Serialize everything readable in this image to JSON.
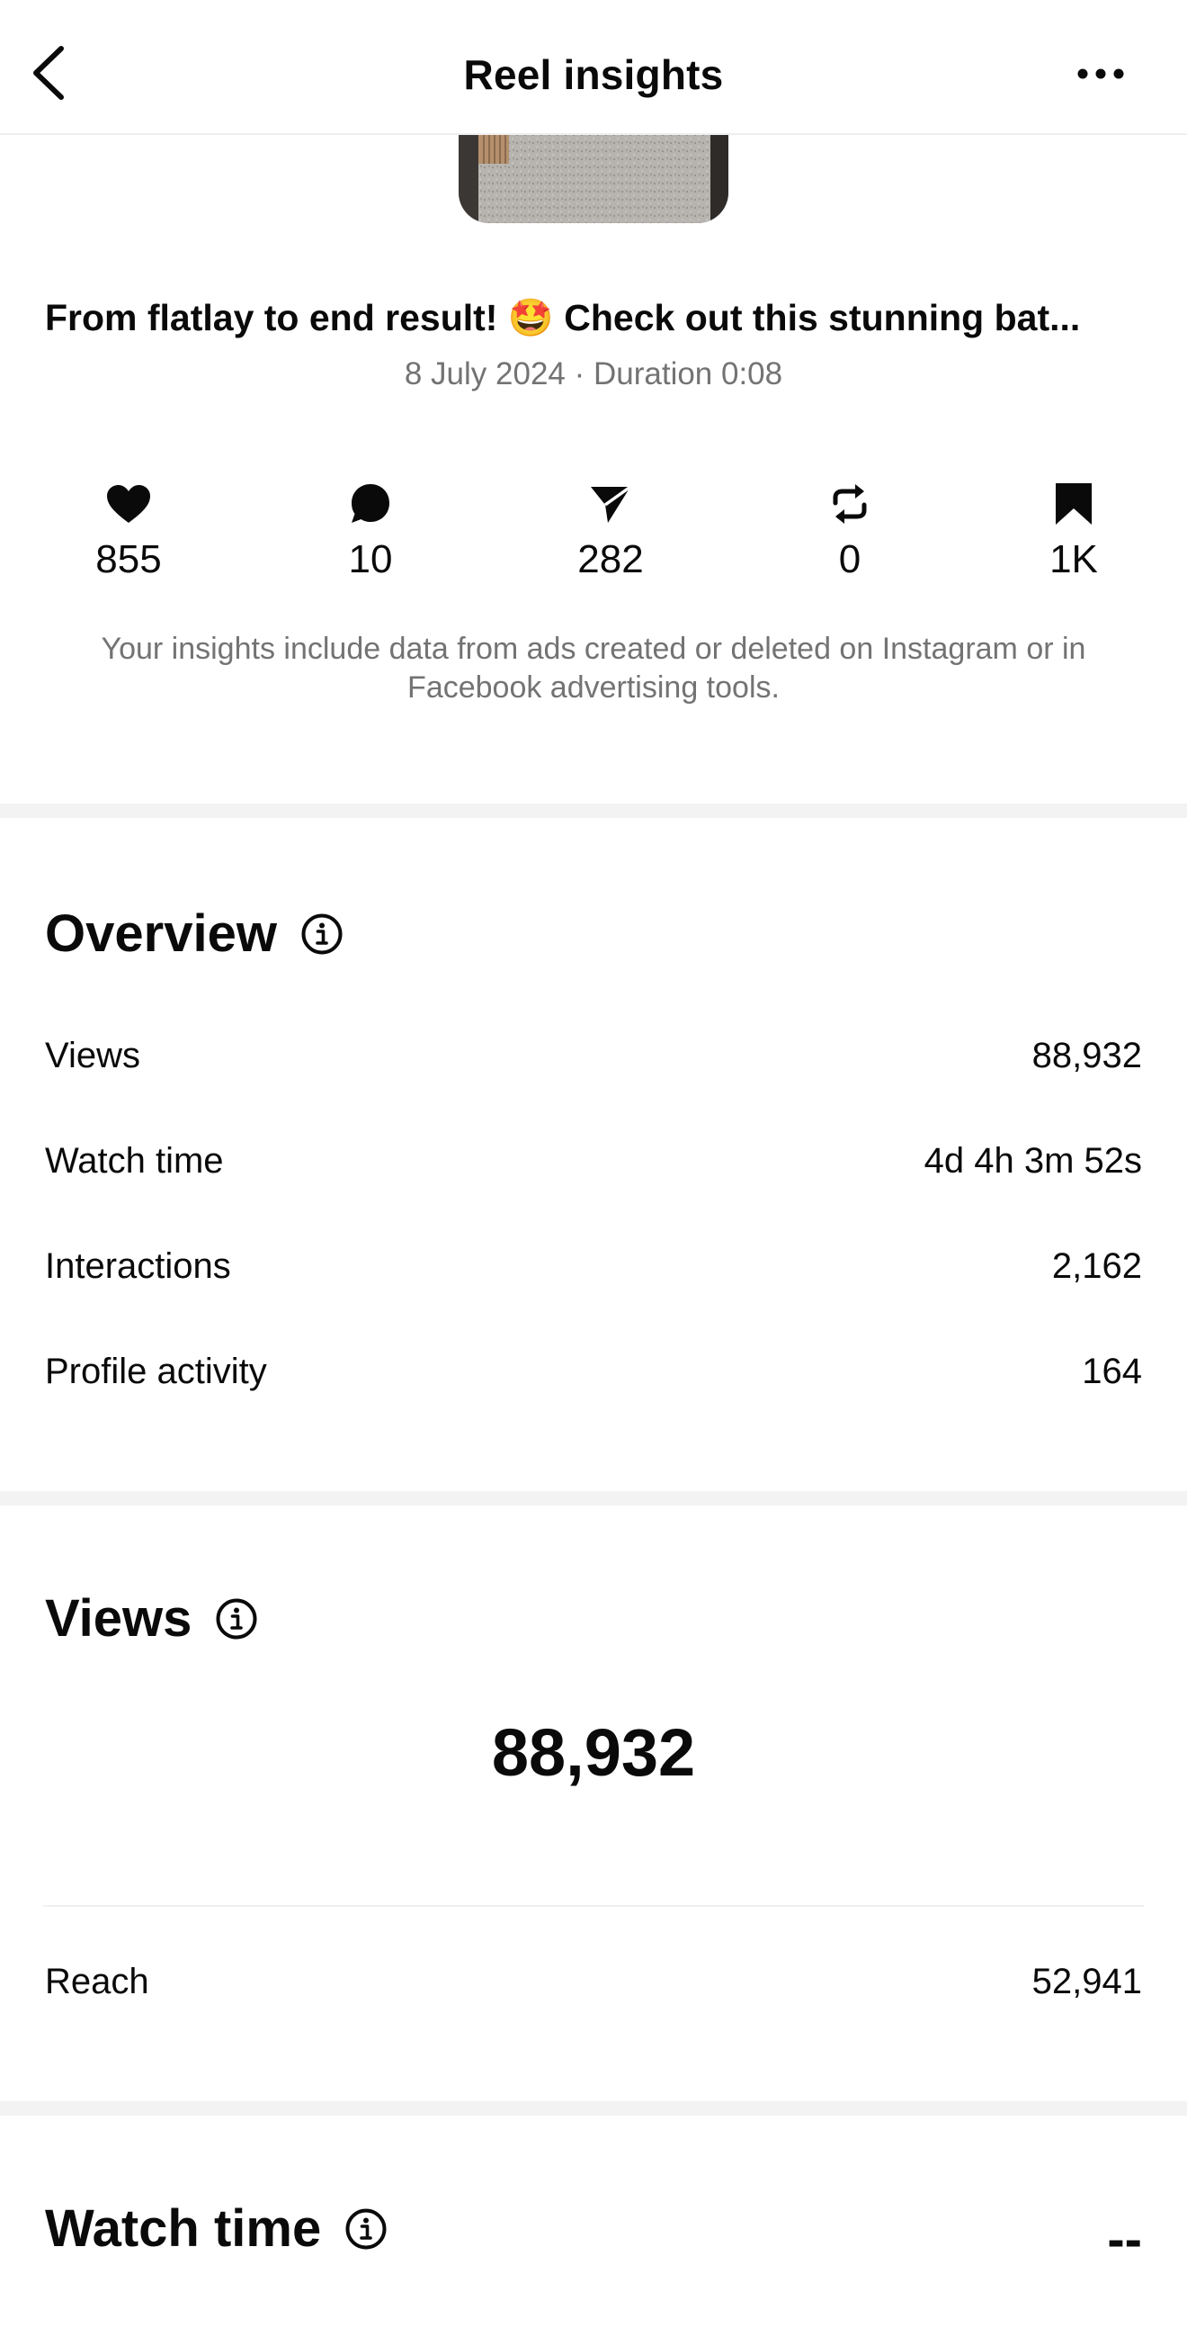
{
  "header": {
    "title": "Reel insights"
  },
  "post": {
    "caption": "From flatlay to end result! 🤩 Check out this stunning bat...",
    "date_duration": "8 July 2024 · Duration 0:08"
  },
  "stats": [
    {
      "icon": "heart-icon",
      "value": "855"
    },
    {
      "icon": "comment-icon",
      "value": "10"
    },
    {
      "icon": "share-icon",
      "value": "282"
    },
    {
      "icon": "repost-icon",
      "value": "0"
    },
    {
      "icon": "bookmark-icon",
      "value": "1K"
    }
  ],
  "disclaimer": "Your insights include data from ads created or deleted on Instagram or in Facebook advertising tools.",
  "overview": {
    "title": "Overview",
    "rows": [
      {
        "label": "Views",
        "value": "88,932"
      },
      {
        "label": "Watch time",
        "value": "4d 4h 3m 52s"
      },
      {
        "label": "Interactions",
        "value": "2,162"
      },
      {
        "label": "Profile activity",
        "value": "164"
      }
    ]
  },
  "views": {
    "title": "Views",
    "total": "88,932",
    "reach_label": "Reach",
    "reach_value": "52,941"
  },
  "watch_time": {
    "title": "Watch time",
    "value": "--"
  }
}
